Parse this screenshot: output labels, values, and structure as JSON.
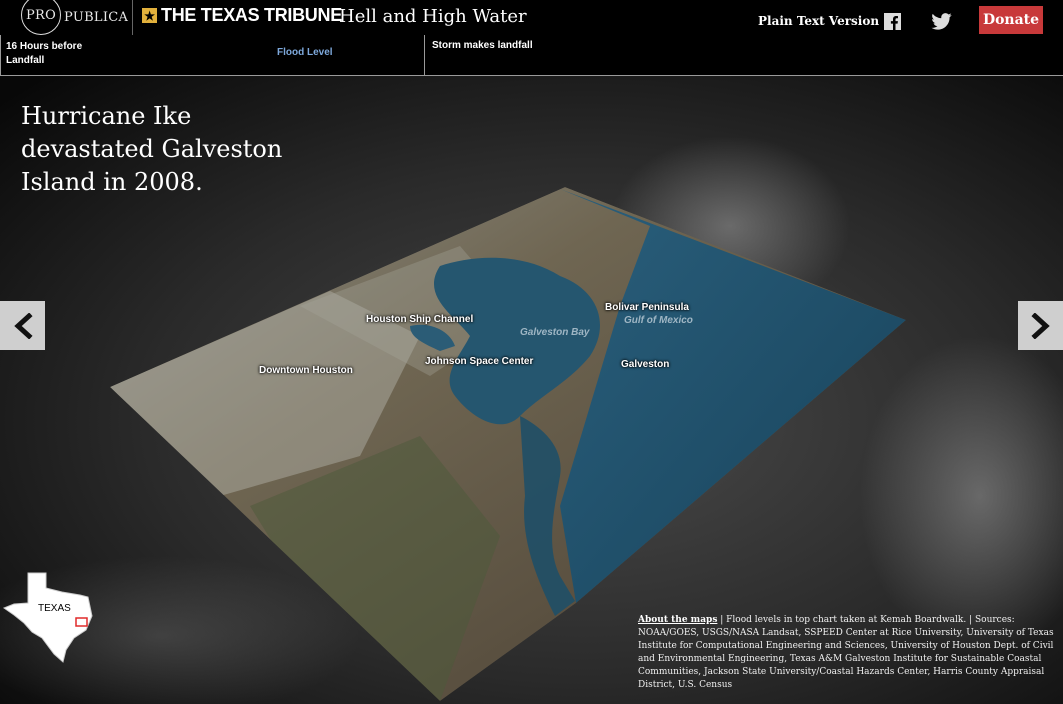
{
  "header": {
    "propublica_pro": "PRO",
    "propublica_publica": "PUBLICA",
    "texas_tribune": "THE TEXAS TRIBUNE",
    "story_title": "Hell and High Water",
    "plain_text_link": "Plain Text Version",
    "donate_label": "Donate",
    "facebook_icon": "facebook-icon",
    "twitter_icon": "twitter-icon",
    "donate_color": "#c8393a",
    "tribune_star_color": "#e2b13c"
  },
  "timeline": {
    "left_label": "16 Hours before Landfall",
    "flood_level_label": "Flood Level",
    "right_label": "Storm makes landfall",
    "flood_label_color": "#7ea9dc"
  },
  "headline": "Hurricane Ike devastated Galveston Island in 2008.",
  "map": {
    "labels": {
      "houston_ship_channel": "Houston Ship Channel",
      "galveston_bay": "Galveston Bay",
      "bolivar_peninsula": "Bolivar Peninsula",
      "gulf_of_mexico": "Gulf of Mexico",
      "downtown_houston": "Downtown Houston",
      "johnson_space_center": "Johnson Space Center",
      "galveston": "Galveston"
    },
    "water_color": "#1d4a62"
  },
  "nav": {
    "prev_icon": "chevron-left-icon",
    "next_icon": "chevron-right-icon"
  },
  "inset": {
    "label": "TEXAS"
  },
  "sources": {
    "about_link": "About the maps",
    "text": "| Flood levels in top chart taken at Kemah Boardwalk. | Sources: NOAA/GOES, USGS/NASA Landsat, SSPEED Center at Rice University, University of Texas Institute for Computational Engineering and Sciences, University of Houston Dept. of Civil and Environmental Engineering, Texas A&M Galveston Institute for Sustainable Coastal Communities, Jackson State University/Coastal Hazards Center, Harris County Appraisal District, U.S. Census"
  }
}
